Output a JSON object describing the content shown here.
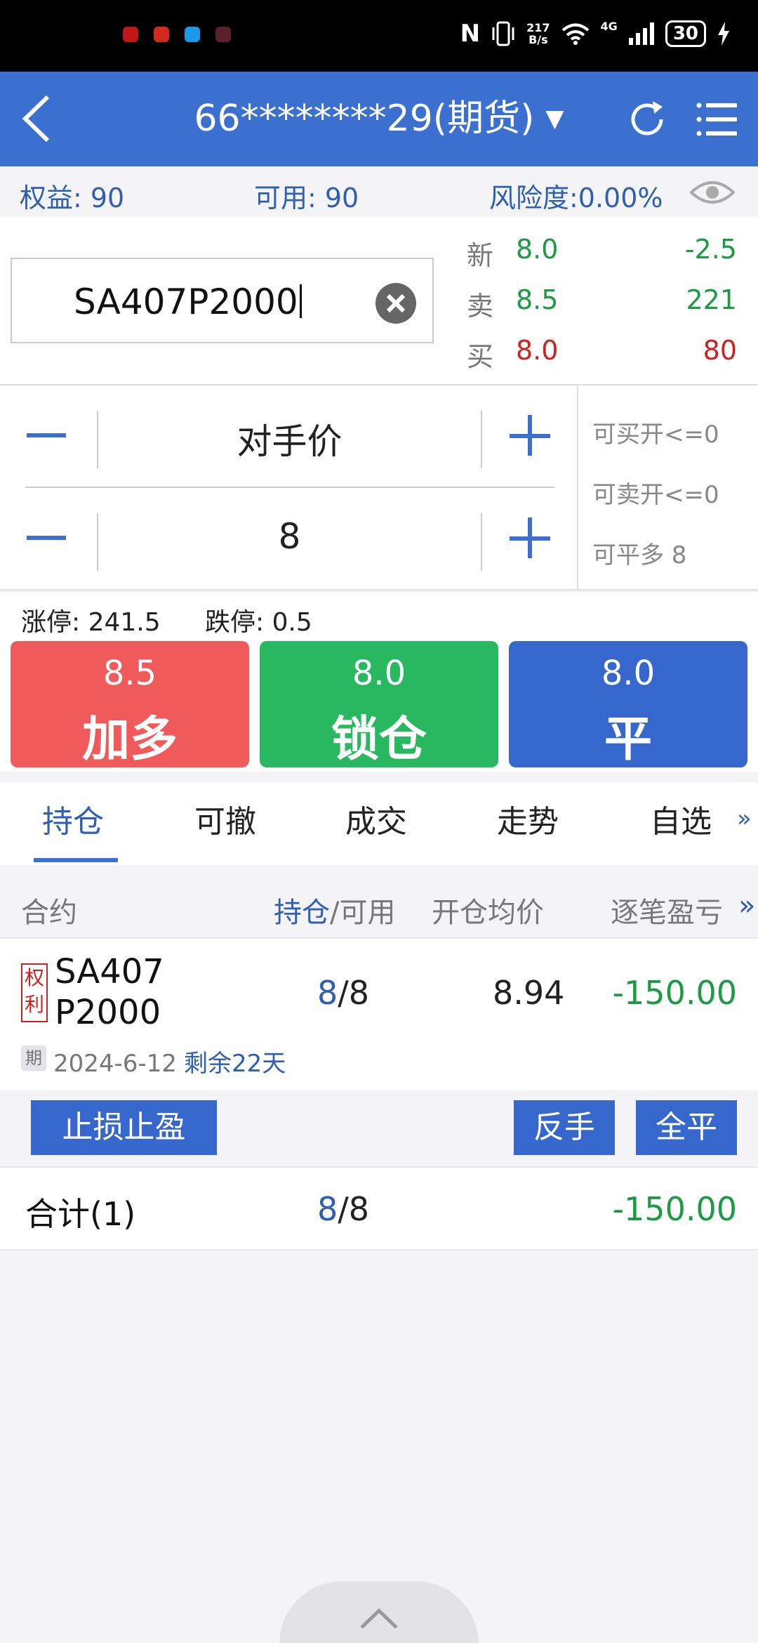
{
  "status_bar": {
    "net_speed_value": "217",
    "net_speed_unit": "B/s",
    "network": "4G",
    "battery": "30"
  },
  "header": {
    "title": "66********29(期货)",
    "caret": "▼"
  },
  "account": {
    "equity": "权益: 90",
    "available": "可用: 90",
    "risk": "风险度:0.00%"
  },
  "quote": {
    "contract_code": "SA407P2000",
    "rows": [
      {
        "label": "新",
        "price": "8.0",
        "value": "-2.5"
      },
      {
        "label": "卖",
        "price": "8.5",
        "value": "221"
      },
      {
        "label": "买",
        "price": "8.0",
        "value": "80"
      }
    ]
  },
  "order": {
    "price_mode": "对手价",
    "quantity": "8",
    "avail": [
      "可买开<=0",
      "可卖开<=0",
      "可平多 8"
    ]
  },
  "limits": {
    "limit_up": "涨停: 241.5",
    "limit_down": "跌停: 0.5"
  },
  "actions": [
    {
      "price": "8.5",
      "label": "加多"
    },
    {
      "price": "8.0",
      "label": "锁仓"
    },
    {
      "price": "8.0",
      "label": "平"
    }
  ],
  "tabs": [
    "持仓",
    "可撤",
    "成交",
    "走势",
    "自选"
  ],
  "tabs_more": "»",
  "table": {
    "headers": {
      "contract": "合约",
      "hold": "持仓",
      "avail_suffix": "/可用",
      "avg_price": "开仓均价",
      "pl": "逐笔盈亏",
      "more": "»"
    },
    "row": {
      "badge": "权利",
      "name_line1": "SA407",
      "name_line2": "P2000",
      "hold": "8",
      "avail": "/8",
      "avg_price": "8.94",
      "pl": "-150.00",
      "period_badge": "期",
      "expiry": "2024-6-12",
      "remaining": "剩余22天"
    },
    "row_actions": [
      "止损止盈",
      "反手",
      "全平"
    ],
    "total": {
      "label": "合计(1)",
      "hold": "8",
      "avail": "/8",
      "pl": "-150.00"
    }
  },
  "colors": {
    "brand_blue": "#3b6fd0",
    "up_red": "#cc2222",
    "down_green": "#1d9a44",
    "button_red": "#f15a5a",
    "button_green": "#27b860",
    "button_blue": "#3567cc"
  }
}
